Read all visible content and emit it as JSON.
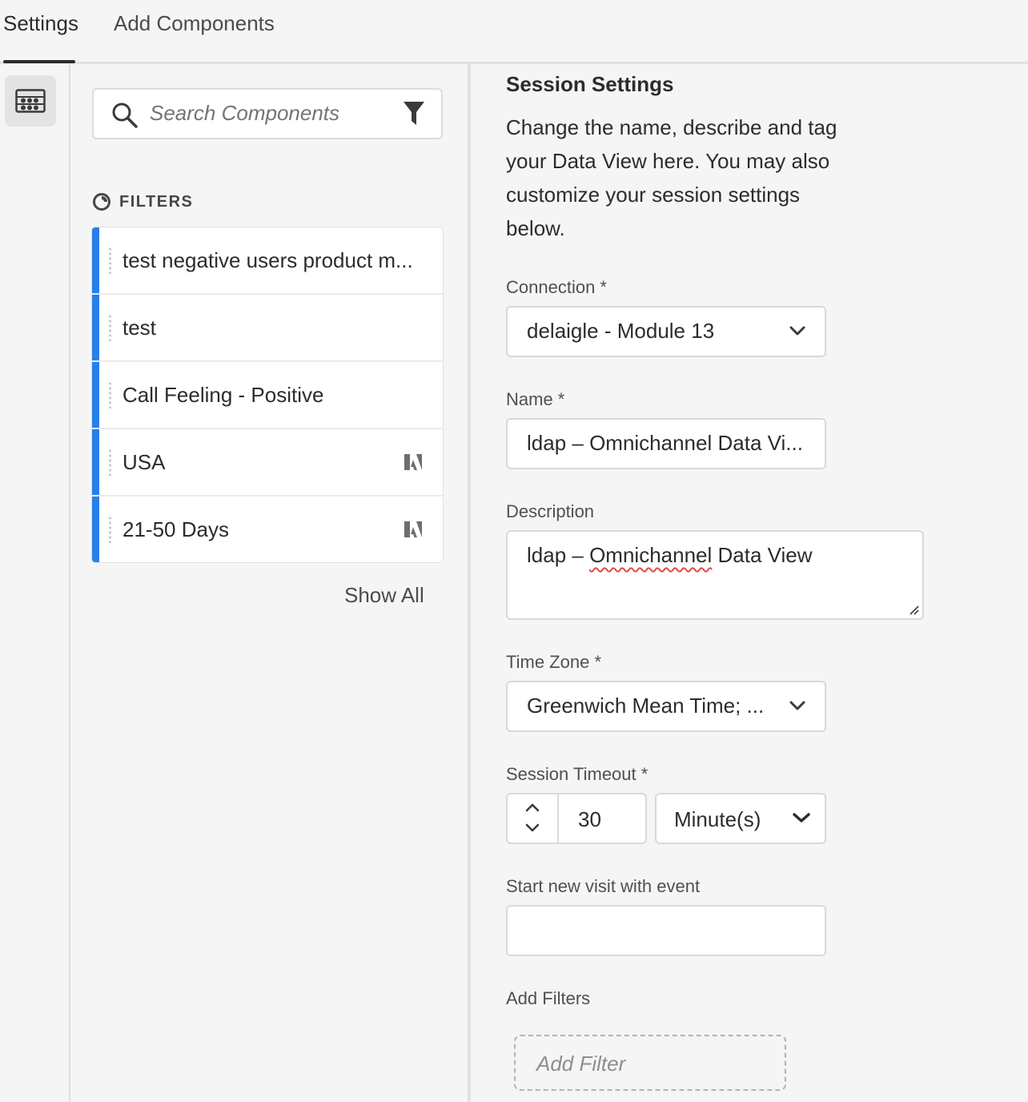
{
  "tabs": [
    {
      "label": "Settings",
      "active": true
    },
    {
      "label": "Add Components",
      "active": false
    }
  ],
  "rail": {
    "icon": "components-panel-icon"
  },
  "components": {
    "search_placeholder": "Search Components",
    "filters_header": "FILTERS",
    "items": [
      {
        "label": "test negative users product m...",
        "adobe_badge": false
      },
      {
        "label": "test",
        "adobe_badge": false
      },
      {
        "label": "Call Feeling - Positive",
        "adobe_badge": false
      },
      {
        "label": "USA",
        "adobe_badge": true
      },
      {
        "label": "21-50 Days",
        "adobe_badge": true
      }
    ],
    "show_all": "Show All",
    "accent": "#2680eb"
  },
  "session": {
    "title": "Session Settings",
    "description": "Change the name, describe and tag your Data View here. You may also customize your session settings below.",
    "connection": {
      "label": "Connection *",
      "value": "delaigle - Module 13"
    },
    "name": {
      "label": "Name *",
      "value": "ldap – Omnichannel Data Vi..."
    },
    "description_field": {
      "label": "Description",
      "prefix": "ldap – ",
      "misspelled": "Omnichannel",
      "suffix": " Data View"
    },
    "time_zone": {
      "label": "Time Zone *",
      "value": "Greenwich Mean Time; ..."
    },
    "timeout": {
      "label": "Session Timeout *",
      "value": "30",
      "unit": "Minute(s)"
    },
    "start_event": {
      "label": "Start new visit with event",
      "value": ""
    },
    "add_filters": {
      "label": "Add Filters",
      "placeholder": "Add Filter"
    }
  }
}
